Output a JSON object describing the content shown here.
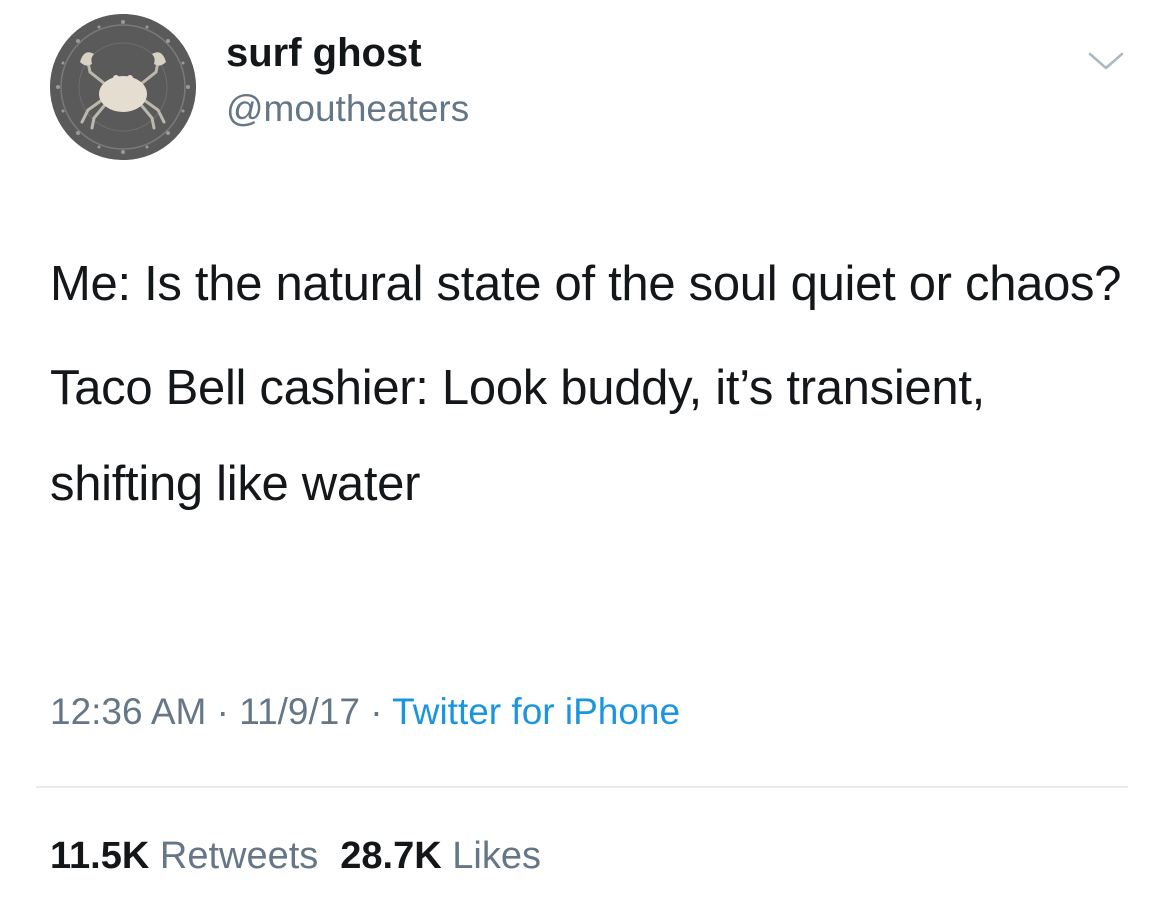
{
  "profile": {
    "display_name": "surf ghost",
    "handle": "@moutheaters",
    "avatar_icon": "crab-icon"
  },
  "menu_icon": "chevron-down-icon",
  "tweet": {
    "paragraphs": [
      "Me: Is the natural state of the soul quiet or chaos?",
      "Taco Bell cashier: Look buddy, it’s transient, shifting like water"
    ]
  },
  "meta": {
    "time": "12:36 AM",
    "date": "11/9/17",
    "separator": "·",
    "source": "Twitter for iPhone"
  },
  "stats": {
    "retweets_count": "11.5K",
    "retweets_label": "Retweets",
    "likes_count": "28.7K",
    "likes_label": "Likes"
  },
  "colors": {
    "text_primary": "#14171a",
    "text_secondary": "#657786",
    "link": "#1b95e0",
    "divider": "#e6ecf0",
    "avatar_bg": "#5c5c5c"
  }
}
